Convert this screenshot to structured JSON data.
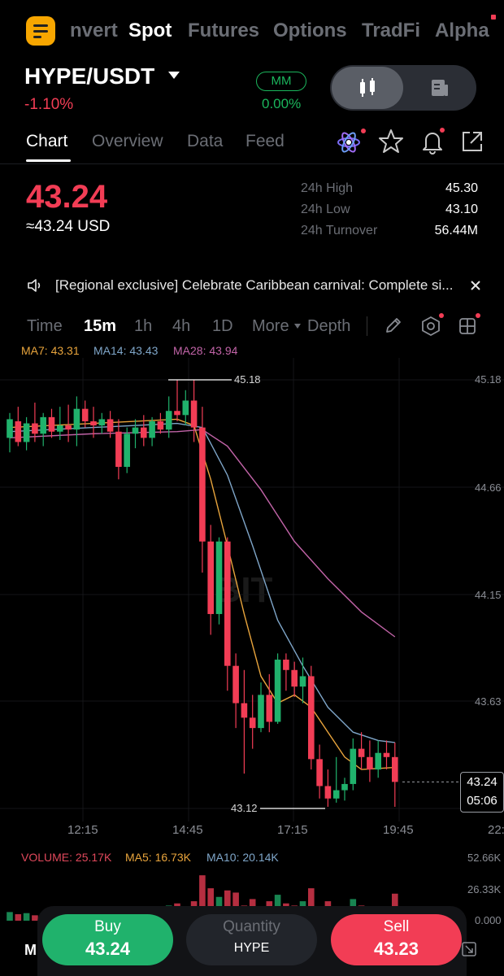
{
  "top_tabs": [
    "nvert",
    "Spot",
    "Futures",
    "Options",
    "TradFi",
    "Alpha"
  ],
  "header": {
    "pair": "HYPE/USDT",
    "change": "-1.10%",
    "mm_badge": "MM",
    "mm_value": "0.00%"
  },
  "sub_tabs": [
    "Chart",
    "Overview",
    "Data",
    "Feed"
  ],
  "price": {
    "last": "43.24",
    "usd": "≈43.24 USD",
    "stats": [
      {
        "label": "24h High",
        "value": "45.30"
      },
      {
        "label": "24h Low",
        "value": "43.10"
      },
      {
        "label": "24h Turnover",
        "value": "56.44M"
      }
    ]
  },
  "announcement": "[Regional exclusive] Celebrate Caribbean carnival: Complete si...",
  "intervals": [
    "Time",
    "15m",
    "1h",
    "4h",
    "1D",
    "More",
    "Depth"
  ],
  "ma_legend": [
    {
      "text": "MA7: 43.31",
      "color": "#e8a43c"
    },
    {
      "text": "MA14: 43.43",
      "color": "#7fa6c9"
    },
    {
      "text": "MA28: 43.94",
      "color": "#c264a8"
    }
  ],
  "volume_legend": [
    {
      "text": "VOLUME: 25.17K",
      "color": "#e0485b"
    },
    {
      "text": "MA5: 16.73K",
      "color": "#e8a43c"
    },
    {
      "text": "MA10: 20.14K",
      "color": "#7fa6c9"
    }
  ],
  "watermark": "BIT",
  "colors": {
    "up": "#20b26c",
    "down": "#f23d55",
    "brand": "#f7a600"
  },
  "chart_data": {
    "type": "candlestick",
    "interval": "15m",
    "y_ticks": [
      "45.18",
      "44.66",
      "44.15",
      "43.63"
    ],
    "x_ticks": [
      "12:15",
      "14:45",
      "17:15",
      "19:45",
      "22:"
    ],
    "annotations": {
      "high": "45.18",
      "low": "43.12"
    },
    "price_tag": {
      "price": "43.24",
      "countdown": "05:06"
    },
    "ylim": [
      43.02,
      45.28
    ],
    "candles": [
      {
        "o": 44.9,
        "h": 45.02,
        "l": 44.83,
        "c": 44.99
      },
      {
        "o": 44.98,
        "h": 45.05,
        "l": 44.86,
        "c": 44.88
      },
      {
        "o": 44.88,
        "h": 45.0,
        "l": 44.84,
        "c": 44.97
      },
      {
        "o": 44.97,
        "h": 45.07,
        "l": 44.88,
        "c": 44.92
      },
      {
        "o": 44.92,
        "h": 45.02,
        "l": 44.86,
        "c": 45.0
      },
      {
        "o": 45.0,
        "h": 45.04,
        "l": 44.9,
        "c": 44.93
      },
      {
        "o": 44.93,
        "h": 45.05,
        "l": 44.89,
        "c": 44.96
      },
      {
        "o": 44.96,
        "h": 45.06,
        "l": 44.88,
        "c": 44.94
      },
      {
        "o": 44.94,
        "h": 45.1,
        "l": 44.86,
        "c": 45.04
      },
      {
        "o": 45.04,
        "h": 45.08,
        "l": 44.95,
        "c": 44.98
      },
      {
        "o": 44.98,
        "h": 45.05,
        "l": 44.9,
        "c": 44.96
      },
      {
        "o": 44.96,
        "h": 45.02,
        "l": 44.92,
        "c": 44.99
      },
      {
        "o": 44.99,
        "h": 45.03,
        "l": 44.9,
        "c": 44.93
      },
      {
        "o": 44.93,
        "h": 44.99,
        "l": 44.7,
        "c": 44.76
      },
      {
        "o": 44.76,
        "h": 44.95,
        "l": 44.73,
        "c": 44.92
      },
      {
        "o": 44.92,
        "h": 44.99,
        "l": 44.85,
        "c": 44.95
      },
      {
        "o": 44.95,
        "h": 45.01,
        "l": 44.86,
        "c": 44.9
      },
      {
        "o": 44.9,
        "h": 45.0,
        "l": 44.86,
        "c": 44.98
      },
      {
        "o": 44.98,
        "h": 45.02,
        "l": 44.92,
        "c": 44.94
      },
      {
        "o": 44.94,
        "h": 45.1,
        "l": 44.9,
        "c": 45.03
      },
      {
        "o": 45.03,
        "h": 45.18,
        "l": 44.98,
        "c": 45.01
      },
      {
        "o": 45.01,
        "h": 45.13,
        "l": 44.96,
        "c": 45.08
      },
      {
        "o": 45.08,
        "h": 45.18,
        "l": 44.88,
        "c": 44.95
      },
      {
        "o": 44.95,
        "h": 45.05,
        "l": 44.25,
        "c": 44.4
      },
      {
        "o": 44.4,
        "h": 44.48,
        "l": 43.95,
        "c": 44.05
      },
      {
        "o": 44.05,
        "h": 44.42,
        "l": 44.0,
        "c": 44.4
      },
      {
        "o": 44.4,
        "h": 44.42,
        "l": 43.68,
        "c": 43.8
      },
      {
        "o": 43.8,
        "h": 43.86,
        "l": 43.5,
        "c": 43.62
      },
      {
        "o": 43.62,
        "h": 43.78,
        "l": 43.28,
        "c": 43.55
      },
      {
        "o": 43.55,
        "h": 43.66,
        "l": 43.4,
        "c": 43.5
      },
      {
        "o": 43.5,
        "h": 43.72,
        "l": 43.48,
        "c": 43.66
      },
      {
        "o": 43.66,
        "h": 43.76,
        "l": 43.48,
        "c": 43.53
      },
      {
        "o": 43.53,
        "h": 43.86,
        "l": 43.52,
        "c": 43.83
      },
      {
        "o": 43.83,
        "h": 43.86,
        "l": 43.68,
        "c": 43.78
      },
      {
        "o": 43.78,
        "h": 43.82,
        "l": 43.65,
        "c": 43.7
      },
      {
        "o": 43.7,
        "h": 43.84,
        "l": 43.62,
        "c": 43.75
      },
      {
        "o": 43.75,
        "h": 43.8,
        "l": 43.3,
        "c": 43.35
      },
      {
        "o": 43.35,
        "h": 43.42,
        "l": 43.16,
        "c": 43.22
      },
      {
        "o": 43.22,
        "h": 43.3,
        "l": 43.12,
        "c": 43.16
      },
      {
        "o": 43.16,
        "h": 43.36,
        "l": 43.14,
        "c": 43.2
      },
      {
        "o": 43.2,
        "h": 43.26,
        "l": 43.15,
        "c": 43.23
      },
      {
        "o": 43.23,
        "h": 43.45,
        "l": 43.2,
        "c": 43.4
      },
      {
        "o": 43.4,
        "h": 43.48,
        "l": 43.3,
        "c": 43.36
      },
      {
        "o": 43.36,
        "h": 43.44,
        "l": 43.24,
        "c": 43.3
      },
      {
        "o": 43.3,
        "h": 43.44,
        "l": 43.26,
        "c": 43.38
      },
      {
        "o": 43.38,
        "h": 43.44,
        "l": 43.3,
        "c": 43.36
      },
      {
        "o": 43.36,
        "h": 43.43,
        "l": 43.12,
        "c": 43.24
      }
    ],
    "ma_series": [
      {
        "name": "MA7",
        "color": "#e8a43c",
        "x": [
          0,
          10,
          20,
          22,
          24,
          26,
          28,
          30,
          32,
          34,
          36,
          38,
          40,
          42,
          46
        ],
        "y": [
          44.95,
          44.97,
          44.99,
          44.96,
          44.7,
          44.38,
          44.05,
          43.75,
          43.62,
          43.66,
          43.6,
          43.48,
          43.36,
          43.3,
          43.31
        ]
      },
      {
        "name": "MA14",
        "color": "#7fa6c9",
        "x": [
          0,
          10,
          20,
          23,
          26,
          29,
          32,
          35,
          38,
          41,
          44,
          46
        ],
        "y": [
          44.93,
          44.95,
          44.97,
          44.95,
          44.72,
          44.38,
          44.02,
          43.8,
          43.6,
          43.48,
          43.44,
          43.43
        ]
      },
      {
        "name": "MA28",
        "color": "#c264a8",
        "x": [
          0,
          10,
          20,
          23,
          26,
          30,
          34,
          38,
          42,
          46
        ],
        "y": [
          44.9,
          44.92,
          44.93,
          44.94,
          44.86,
          44.65,
          44.4,
          44.22,
          44.06,
          43.94
        ]
      }
    ],
    "volume": {
      "max": 52.66,
      "y_ticks": [
        "52.66K",
        "26.33K",
        "0.000"
      ],
      "values": [
        8,
        6,
        7,
        5,
        6,
        7,
        5,
        6,
        8,
        6,
        7,
        5,
        6,
        9,
        7,
        6,
        8,
        9,
        10,
        14,
        16,
        12,
        18,
        42,
        30,
        22,
        28,
        26,
        14,
        20,
        12,
        18,
        24,
        16,
        14,
        18,
        30,
        12,
        18,
        10,
        9,
        20,
        14,
        12,
        10,
        8,
        25
      ]
    }
  },
  "bottom": {
    "buy_label": "Buy",
    "buy_price": "43.24",
    "qty_label": "Quantity",
    "qty_unit": "HYPE",
    "sell_label": "Sell",
    "sell_price": "43.23",
    "left_label": "M"
  }
}
